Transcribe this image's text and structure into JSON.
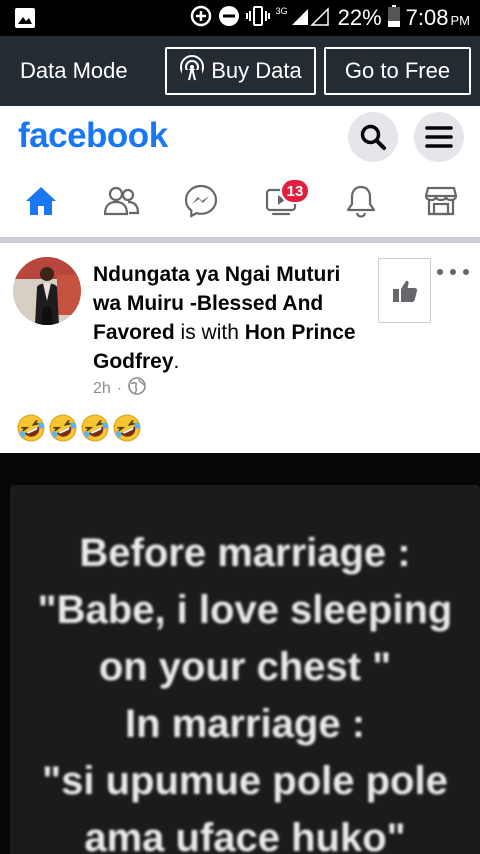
{
  "status_bar": {
    "battery": "22%",
    "time": "7:08",
    "ampm": "PM",
    "network": "3G"
  },
  "data_bar": {
    "mode_label": "Data Mode",
    "buy_label": "Buy Data",
    "free_label": "Go to Free"
  },
  "header": {
    "logo": "facebook"
  },
  "nav": {
    "badge_count": "13"
  },
  "post": {
    "author": "Ndungata ya Ngai Muturi wa Muiru -Blessed And Favored",
    "with_text": " is with ",
    "tagged": "Hon Prince Godfrey",
    "period": ".",
    "time": "2h",
    "separator": "·",
    "privacy_icon": "globe-icon",
    "text_emojis": [
      "🤣",
      "🤣",
      "🤣",
      "🤣"
    ]
  },
  "meme": {
    "lines": [
      "Before marriage :",
      "\"Babe, i love sleeping",
      "on your chest \"",
      "In marriage :",
      "\"si upumue pole pole",
      "ama uface huko\""
    ]
  },
  "colors": {
    "brand": "#1877f2",
    "badge": "#e41e3f",
    "data_bar_bg": "#232b33"
  }
}
